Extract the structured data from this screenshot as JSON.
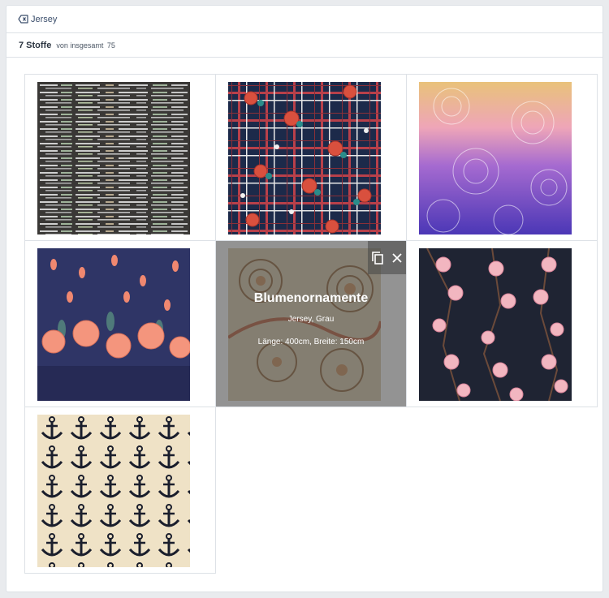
{
  "filter": {
    "chip_label": "Jersey",
    "icon": "backspace-icon"
  },
  "summary": {
    "count": "7 Stoffe",
    "total_label": "von insgesamt",
    "total": "75"
  },
  "fabrics": [
    {
      "id": "code-print",
      "pattern": "code"
    },
    {
      "id": "tartan-roses",
      "pattern": "tartan"
    },
    {
      "id": "mandala-gradient",
      "pattern": "mandala"
    },
    {
      "id": "pink-flower-border",
      "pattern": "floral-border"
    },
    {
      "id": "blumenornamente",
      "pattern": "ornament",
      "hovered": true,
      "title": "Blumenornamente",
      "material": "Jersey, Grau",
      "dimensions": "Länge: 400cm, Breite: 150cm",
      "tools": [
        "copy-icon",
        "close-icon"
      ]
    },
    {
      "id": "cherry-blossom",
      "pattern": "blossom"
    },
    {
      "id": "anchors",
      "pattern": "anchor"
    }
  ],
  "colors": {
    "accent": "#3a4d6b",
    "border": "#dde1e6",
    "overlay": "#505050"
  }
}
